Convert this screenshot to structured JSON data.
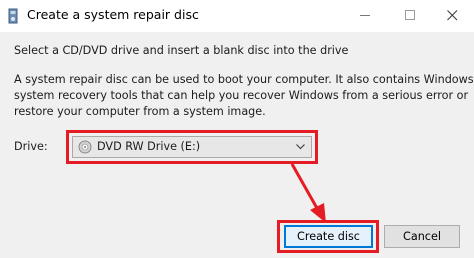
{
  "window": {
    "title": "Create a system repair disc",
    "controls": {
      "minimize_icon": "minimize-icon",
      "maximize_icon": "maximize-icon",
      "close_icon": "close-icon"
    }
  },
  "content": {
    "instruction": "Select a CD/DVD drive and insert a blank disc into the drive",
    "description_lines": [
      "A system repair disc can be used to boot your computer. It also contains Windows",
      "system recovery tools that can help you recover Windows from a serious error or",
      "restore your computer from a system image."
    ]
  },
  "drive": {
    "label": "Drive:",
    "selected": "DVD RW Drive (E:)",
    "icon": "disc-drive-icon"
  },
  "buttons": {
    "create": "Create disc",
    "cancel": "Cancel"
  },
  "annotation": {
    "highlight_color": "#e51c23"
  }
}
